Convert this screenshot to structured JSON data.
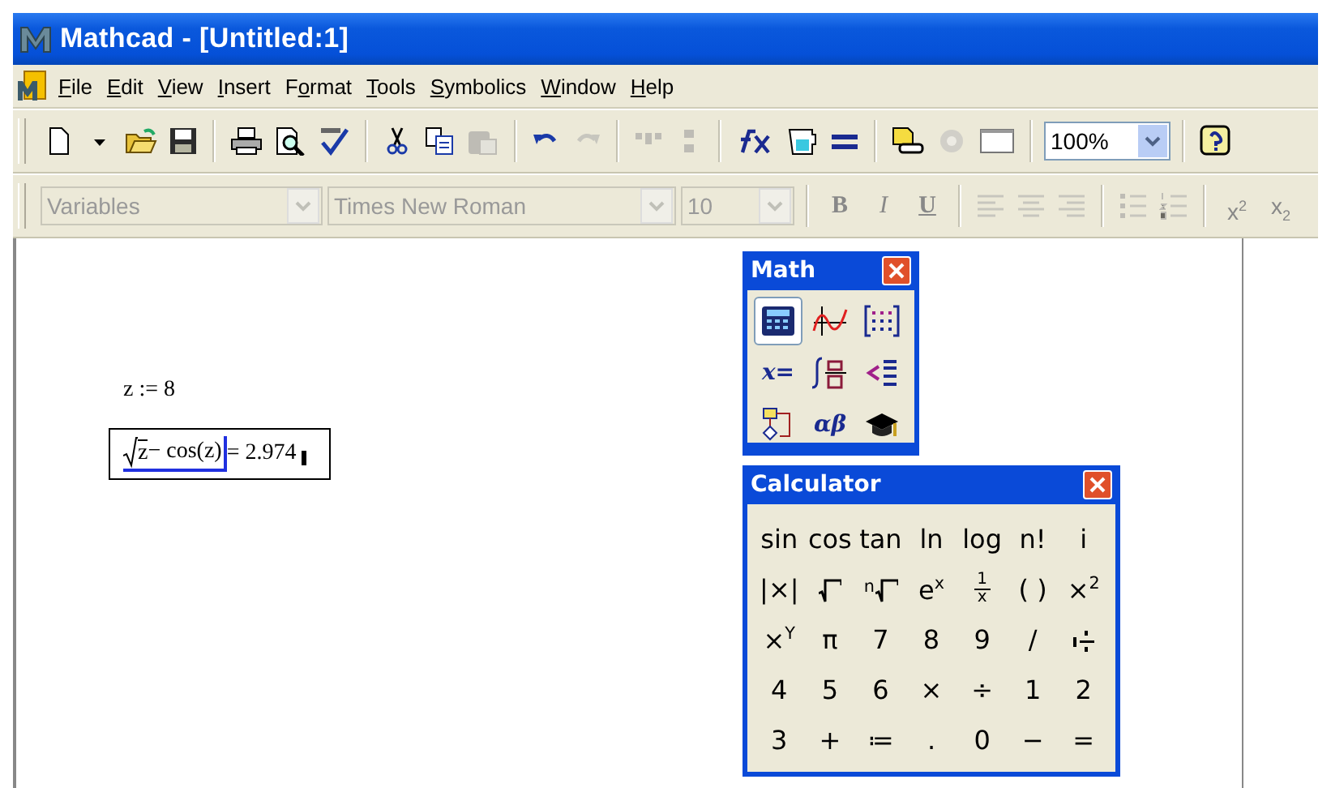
{
  "window": {
    "title": "Mathcad - [Untitled:1]"
  },
  "menu": [
    {
      "label": "File"
    },
    {
      "label": "Edit"
    },
    {
      "label": "View"
    },
    {
      "label": "Insert"
    },
    {
      "label": "Format"
    },
    {
      "label": "Tools"
    },
    {
      "label": "Symbolics"
    },
    {
      "label": "Window"
    },
    {
      "label": "Help"
    }
  ],
  "toolbar": [
    {
      "kind": "icon",
      "disabled": false
    },
    {
      "kind": "icon",
      "disabled": false
    },
    {
      "kind": "icon",
      "disabled": false
    },
    {
      "kind": "icon",
      "disabled": false
    },
    {
      "kind": "separator"
    },
    {
      "kind": "icon",
      "disabled": false
    },
    {
      "kind": "icon",
      "disabled": false
    },
    {
      "kind": "icon",
      "disabled": false
    },
    {
      "kind": "separator"
    },
    {
      "kind": "icon",
      "disabled": false
    },
    {
      "kind": "icon",
      "disabled": false
    },
    {
      "kind": "icon",
      "disabled": true
    },
    {
      "kind": "separator"
    },
    {
      "kind": "icon",
      "disabled": false
    },
    {
      "kind": "icon",
      "disabled": true
    },
    {
      "kind": "separator"
    },
    {
      "kind": "icon",
      "disabled": true
    },
    {
      "kind": "icon",
      "disabled": true
    },
    {
      "kind": "separator"
    },
    {
      "kind": "icon",
      "disabled": false
    },
    {
      "kind": "icon",
      "disabled": false
    },
    {
      "kind": "icon",
      "disabled": false
    },
    {
      "kind": "separator"
    },
    {
      "kind": "icon",
      "disabled": false
    },
    {
      "kind": "icon",
      "disabled": true
    },
    {
      "kind": "icon",
      "disabled": false
    },
    {
      "kind": "separator"
    },
    {
      "kind": "combo",
      "value": "100%",
      "disabled": false
    },
    {
      "kind": "separator"
    },
    {
      "kind": "icon",
      "disabled": false
    }
  ],
  "format_toolbar": [
    {
      "kind": "combo",
      "value": "Variables",
      "disabled": true
    },
    {
      "kind": "combo",
      "value": "Times New Roman",
      "disabled": true
    },
    {
      "kind": "combo",
      "value": "10",
      "disabled": true
    },
    {
      "kind": "separator"
    },
    {
      "kind": "text",
      "label": "B",
      "disabled": true
    },
    {
      "kind": "text",
      "label": "I",
      "disabled": true
    },
    {
      "kind": "text",
      "label": "U",
      "disabled": true
    },
    {
      "kind": "separator"
    },
    {
      "kind": "icon",
      "disabled": true
    },
    {
      "kind": "icon",
      "disabled": true
    },
    {
      "kind": "icon",
      "disabled": true
    },
    {
      "kind": "separator"
    },
    {
      "kind": "icon",
      "disabled": true
    },
    {
      "kind": "icon",
      "disabled": true
    },
    {
      "kind": "separator"
    },
    {
      "kind": "text",
      "label": "x$^{2}$",
      "disabled": true
    },
    {
      "kind": "text",
      "label": "x$_{2}$",
      "disabled": true
    }
  ],
  "worksheet": {
    "regions": [
      {
        "kind": "define",
        "text": "z := 8"
      },
      {
        "kind": "eval",
        "radicand": "z",
        "rest": " − cos(z)",
        "result": " = 2.974",
        "selected": true
      }
    ]
  },
  "math_palette": {
    "title": "Math",
    "buttons": [
      {
        "kind": "icon",
        "selected": true
      },
      {
        "kind": "icon",
        "selected": false
      },
      {
        "kind": "icon",
        "selected": false
      },
      {
        "kind": "text",
        "label": "x=",
        "selected": false
      },
      {
        "kind": "icon",
        "selected": false
      },
      {
        "kind": "icon",
        "selected": false
      },
      {
        "kind": "icon",
        "selected": false
      },
      {
        "kind": "text",
        "label": "αβ",
        "selected": false
      },
      {
        "kind": "icon",
        "selected": false
      }
    ]
  },
  "calculator": {
    "title": "Calculator",
    "keys": [
      {
        "kind": "text",
        "label": "sin"
      },
      {
        "kind": "text",
        "label": "cos"
      },
      {
        "kind": "text",
        "label": "tan"
      },
      {
        "kind": "text",
        "label": "ln"
      },
      {
        "kind": "text",
        "label": "log"
      },
      {
        "kind": "text",
        "label": "n!"
      },
      {
        "kind": "text",
        "label": "i"
      },
      {
        "kind": "text",
        "label": "|×|"
      },
      {
        "kind": "root"
      },
      {
        "kind": "root",
        "index": "n"
      },
      {
        "kind": "text",
        "label": "e$^{x}$"
      },
      {
        "kind": "frac",
        "num": "1",
        "den": "x"
      },
      {
        "kind": "text",
        "label": "( )"
      },
      {
        "kind": "text",
        "label": "×$^{2}$"
      },
      {
        "kind": "text",
        "label": "×$^{Y}$"
      },
      {
        "kind": "text",
        "label": "π"
      },
      {
        "kind": "text",
        "label": "7"
      },
      {
        "kind": "text",
        "label": "8"
      },
      {
        "kind": "text",
        "label": "9"
      },
      {
        "kind": "text",
        "label": "/"
      },
      {
        "kind": "mixed"
      },
      {
        "kind": "text",
        "label": "4"
      },
      {
        "kind": "text",
        "label": "5"
      },
      {
        "kind": "text",
        "label": "6"
      },
      {
        "kind": "text",
        "label": "×"
      },
      {
        "kind": "text",
        "label": "÷"
      },
      {
        "kind": "text",
        "label": "1"
      },
      {
        "kind": "text",
        "label": "2"
      },
      {
        "kind": "text",
        "label": "3"
      },
      {
        "kind": "text",
        "label": "+"
      },
      {
        "kind": "text",
        "label": "≔"
      },
      {
        "kind": "text",
        "label": "."
      },
      {
        "kind": "text",
        "label": "0"
      },
      {
        "kind": "text",
        "label": "−"
      },
      {
        "kind": "text",
        "label": "="
      }
    ]
  }
}
